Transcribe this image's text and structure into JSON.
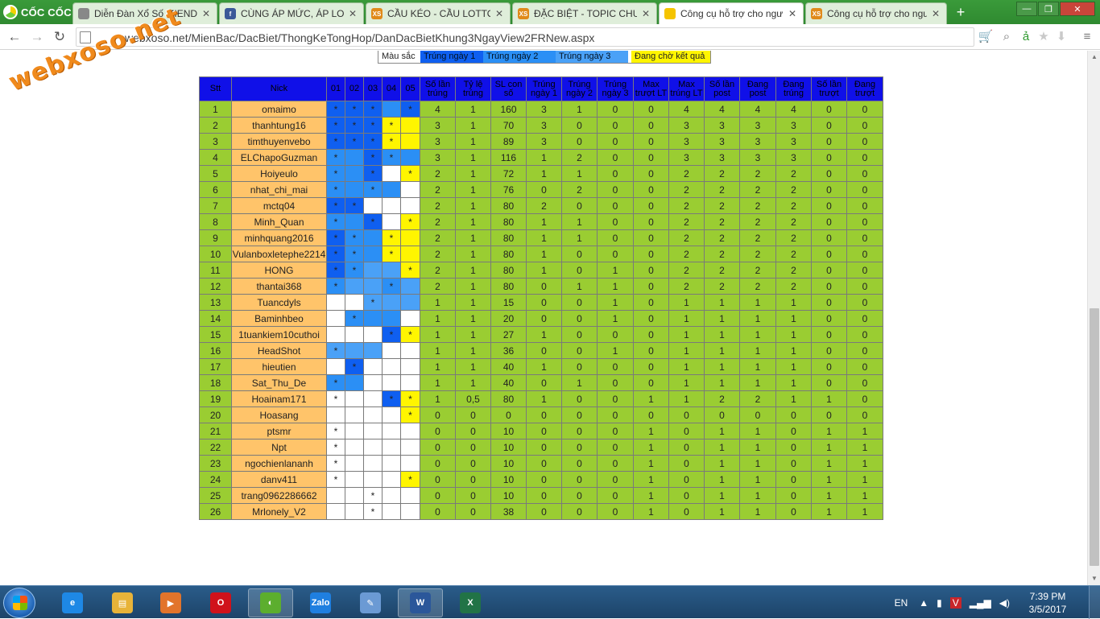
{
  "browser": {
    "brand": "CỐC CỐC",
    "tabs": [
      {
        "label": "Diễn Đàn Xổ Số MIENDA",
        "icon": "doc-icon",
        "color": "#888888"
      },
      {
        "label": "CÙNG ÁP MỨC, ÁP LOẠI",
        "icon": "facebook-icon",
        "color": "#3b5998"
      },
      {
        "label": "CẦU KÉO - CẦU LOTTO.I",
        "icon": "xs-icon",
        "color": "#e08a1a"
      },
      {
        "label": "ĐẶC BIỆT - TOPIC CHUY",
        "icon": "xs-icon",
        "color": "#e08a1a"
      },
      {
        "label": "Công cụ hỗ trợ cho ngư",
        "icon": "coccoc-icon",
        "color": "#f5c400"
      },
      {
        "label": "Công cụ hỗ trợ cho ngư",
        "icon": "xs-icon",
        "color": "#e08a1a"
      }
    ],
    "url": "webxoso.net/MienBac/DacBiet/ThongKeTongHop/DanDacBietKhung3NgayView2FRNew.aspx"
  },
  "watermark": "webxoso.net",
  "legend": {
    "title": "Màu sắc",
    "day1": "Trúng ngày 1",
    "day2": "Trúng ngày 2",
    "day3": "Trúng ngày 3",
    "pending": "Đang chờ kết quả"
  },
  "table": {
    "headers": [
      "Stt",
      "Nick",
      "01",
      "02",
      "03",
      "04",
      "05",
      "Số lần trúng",
      "Tỷ lệ trúng",
      "SL con số",
      "Trúng ngày 1",
      "Trúng ngày 2",
      "Trúng ngày 3",
      "Max trượt LT",
      "Max trúng LT",
      "Số lần post",
      "Đang post",
      "Đang trúng",
      "Số lần trượt",
      "Đang trượt"
    ],
    "rows": [
      {
        "stt": "1",
        "nick": "omaimo",
        "days": [
          [
            "d1",
            "*"
          ],
          [
            "d1",
            "*"
          ],
          [
            "d1",
            "*"
          ],
          [
            "d2",
            ""
          ],
          [
            "d1",
            "*"
          ]
        ],
        "stats": [
          "4",
          "1",
          "160",
          "3",
          "1",
          "0",
          "0",
          "4",
          "4",
          "4",
          "4",
          "0",
          "0"
        ]
      },
      {
        "stt": "2",
        "nick": "thanhtung16",
        "days": [
          [
            "d1",
            "*"
          ],
          [
            "d1",
            "*"
          ],
          [
            "d1",
            "*"
          ],
          [
            "pend",
            "*"
          ],
          [
            "pend",
            ""
          ]
        ],
        "stats": [
          "3",
          "1",
          "70",
          "3",
          "0",
          "0",
          "0",
          "3",
          "3",
          "3",
          "3",
          "0",
          "0"
        ]
      },
      {
        "stt": "3",
        "nick": "timthuyenvebo",
        "days": [
          [
            "d1",
            "*"
          ],
          [
            "d1",
            "*"
          ],
          [
            "d1",
            "*"
          ],
          [
            "pend",
            "*"
          ],
          [
            "pend",
            ""
          ]
        ],
        "stats": [
          "3",
          "1",
          "89",
          "3",
          "0",
          "0",
          "0",
          "3",
          "3",
          "3",
          "3",
          "0",
          "0"
        ]
      },
      {
        "stt": "4",
        "nick": "ELChapoGuzman",
        "days": [
          [
            "d2",
            "*"
          ],
          [
            "d2",
            ""
          ],
          [
            "d1",
            "*"
          ],
          [
            "d2",
            "*"
          ],
          [
            "d2",
            ""
          ]
        ],
        "stats": [
          "3",
          "1",
          "116",
          "1",
          "2",
          "0",
          "0",
          "3",
          "3",
          "3",
          "3",
          "0",
          "0"
        ]
      },
      {
        "stt": "5",
        "nick": "Hoiyeulo",
        "days": [
          [
            "d2",
            "*"
          ],
          [
            "d2",
            ""
          ],
          [
            "d1",
            "*"
          ],
          [
            "w",
            ""
          ],
          [
            "pend",
            "*"
          ]
        ],
        "stats": [
          "2",
          "1",
          "72",
          "1",
          "1",
          "0",
          "0",
          "2",
          "2",
          "2",
          "2",
          "0",
          "0"
        ]
      },
      {
        "stt": "6",
        "nick": "nhat_chi_mai",
        "days": [
          [
            "d2",
            "*"
          ],
          [
            "d2",
            ""
          ],
          [
            "d2",
            "*"
          ],
          [
            "d2",
            ""
          ],
          [
            "w",
            ""
          ]
        ],
        "stats": [
          "2",
          "1",
          "76",
          "0",
          "2",
          "0",
          "0",
          "2",
          "2",
          "2",
          "2",
          "0",
          "0"
        ]
      },
      {
        "stt": "7",
        "nick": "mctq04",
        "days": [
          [
            "d1",
            "*"
          ],
          [
            "d1",
            "*"
          ],
          [
            "w",
            ""
          ],
          [
            "w",
            ""
          ],
          [
            "w",
            ""
          ]
        ],
        "stats": [
          "2",
          "1",
          "80",
          "2",
          "0",
          "0",
          "0",
          "2",
          "2",
          "2",
          "2",
          "0",
          "0"
        ]
      },
      {
        "stt": "8",
        "nick": "Minh_Quan",
        "days": [
          [
            "d2",
            "*"
          ],
          [
            "d2",
            ""
          ],
          [
            "d1",
            "*"
          ],
          [
            "w",
            ""
          ],
          [
            "pend",
            "*"
          ]
        ],
        "stats": [
          "2",
          "1",
          "80",
          "1",
          "1",
          "0",
          "0",
          "2",
          "2",
          "2",
          "2",
          "0",
          "0"
        ]
      },
      {
        "stt": "9",
        "nick": "minhquang2016",
        "days": [
          [
            "d1",
            "*"
          ],
          [
            "d2",
            "*"
          ],
          [
            "d2",
            ""
          ],
          [
            "pend",
            "*"
          ],
          [
            "pend",
            ""
          ]
        ],
        "stats": [
          "2",
          "1",
          "80",
          "1",
          "1",
          "0",
          "0",
          "2",
          "2",
          "2",
          "2",
          "0",
          "0"
        ]
      },
      {
        "stt": "10",
        "nick": "Vulanboxletephe2214",
        "days": [
          [
            "d1",
            "*"
          ],
          [
            "d2",
            "*"
          ],
          [
            "d2",
            ""
          ],
          [
            "pend",
            "*"
          ],
          [
            "pend",
            ""
          ]
        ],
        "stats": [
          "2",
          "1",
          "80",
          "1",
          "0",
          "0",
          "0",
          "2",
          "2",
          "2",
          "2",
          "0",
          "0"
        ]
      },
      {
        "stt": "11",
        "nick": "HONG",
        "days": [
          [
            "d1",
            "*"
          ],
          [
            "d2",
            "*"
          ],
          [
            "d3",
            ""
          ],
          [
            "d3",
            ""
          ],
          [
            "pend",
            "*"
          ]
        ],
        "stats": [
          "2",
          "1",
          "80",
          "1",
          "0",
          "1",
          "0",
          "2",
          "2",
          "2",
          "2",
          "0",
          "0"
        ]
      },
      {
        "stt": "12",
        "nick": "thantai368",
        "days": [
          [
            "d2",
            "*"
          ],
          [
            "d3",
            ""
          ],
          [
            "d3",
            ""
          ],
          [
            "d2",
            "*"
          ],
          [
            "d3",
            ""
          ]
        ],
        "stats": [
          "2",
          "1",
          "80",
          "0",
          "1",
          "1",
          "0",
          "2",
          "2",
          "2",
          "2",
          "0",
          "0"
        ]
      },
      {
        "stt": "13",
        "nick": "Tuancdyls",
        "days": [
          [
            "w",
            ""
          ],
          [
            "w",
            ""
          ],
          [
            "d3",
            "*"
          ],
          [
            "d3",
            ""
          ],
          [
            "d3",
            ""
          ]
        ],
        "stats": [
          "1",
          "1",
          "15",
          "0",
          "0",
          "1",
          "0",
          "1",
          "1",
          "1",
          "1",
          "0",
          "0"
        ]
      },
      {
        "stt": "14",
        "nick": "Baminhbeo",
        "days": [
          [
            "w",
            ""
          ],
          [
            "d2",
            "*"
          ],
          [
            "d2",
            ""
          ],
          [
            "d2",
            ""
          ],
          [
            "w",
            ""
          ]
        ],
        "stats": [
          "1",
          "1",
          "20",
          "0",
          "0",
          "1",
          "0",
          "1",
          "1",
          "1",
          "1",
          "0",
          "0"
        ]
      },
      {
        "stt": "15",
        "nick": "1tuankiem10cuthoi",
        "days": [
          [
            "w",
            ""
          ],
          [
            "w",
            ""
          ],
          [
            "w",
            ""
          ],
          [
            "d1",
            "*"
          ],
          [
            "pend",
            "*"
          ]
        ],
        "stats": [
          "1",
          "1",
          "27",
          "1",
          "0",
          "0",
          "0",
          "1",
          "1",
          "1",
          "1",
          "0",
          "0"
        ]
      },
      {
        "stt": "16",
        "nick": "HeadShot",
        "days": [
          [
            "d3",
            "*"
          ],
          [
            "d3",
            ""
          ],
          [
            "d3",
            ""
          ],
          [
            "w",
            ""
          ],
          [
            "w",
            ""
          ]
        ],
        "stats": [
          "1",
          "1",
          "36",
          "0",
          "0",
          "1",
          "0",
          "1",
          "1",
          "1",
          "1",
          "0",
          "0"
        ]
      },
      {
        "stt": "17",
        "nick": "hieutien",
        "days": [
          [
            "w",
            ""
          ],
          [
            "d1",
            "*"
          ],
          [
            "w",
            ""
          ],
          [
            "w",
            ""
          ],
          [
            "w",
            ""
          ]
        ],
        "stats": [
          "1",
          "1",
          "40",
          "1",
          "0",
          "0",
          "0",
          "1",
          "1",
          "1",
          "1",
          "0",
          "0"
        ]
      },
      {
        "stt": "18",
        "nick": "Sat_Thu_De",
        "days": [
          [
            "d2",
            "*"
          ],
          [
            "d2",
            ""
          ],
          [
            "w",
            ""
          ],
          [
            "w",
            ""
          ],
          [
            "w",
            ""
          ]
        ],
        "stats": [
          "1",
          "1",
          "40",
          "0",
          "1",
          "0",
          "0",
          "1",
          "1",
          "1",
          "1",
          "0",
          "0"
        ]
      },
      {
        "stt": "19",
        "nick": "Hoainam171",
        "days": [
          [
            "w",
            "*"
          ],
          [
            "w",
            ""
          ],
          [
            "w",
            ""
          ],
          [
            "d1",
            "*"
          ],
          [
            "pend",
            "*"
          ]
        ],
        "stats": [
          "1",
          "0,5",
          "80",
          "1",
          "0",
          "0",
          "1",
          "1",
          "2",
          "2",
          "1",
          "1",
          "0"
        ]
      },
      {
        "stt": "20",
        "nick": "Hoasang",
        "days": [
          [
            "w",
            ""
          ],
          [
            "w",
            ""
          ],
          [
            "w",
            ""
          ],
          [
            "w",
            ""
          ],
          [
            "pend",
            "*"
          ]
        ],
        "stats": [
          "0",
          "0",
          "0",
          "0",
          "0",
          "0",
          "0",
          "0",
          "0",
          "0",
          "0",
          "0",
          "0"
        ]
      },
      {
        "stt": "21",
        "nick": "ptsmr",
        "days": [
          [
            "w",
            "*"
          ],
          [
            "w",
            ""
          ],
          [
            "w",
            ""
          ],
          [
            "w",
            ""
          ],
          [
            "w",
            ""
          ]
        ],
        "stats": [
          "0",
          "0",
          "10",
          "0",
          "0",
          "0",
          "1",
          "0",
          "1",
          "1",
          "0",
          "1",
          "1"
        ]
      },
      {
        "stt": "22",
        "nick": "Npt",
        "days": [
          [
            "w",
            "*"
          ],
          [
            "w",
            ""
          ],
          [
            "w",
            ""
          ],
          [
            "w",
            ""
          ],
          [
            "w",
            ""
          ]
        ],
        "stats": [
          "0",
          "0",
          "10",
          "0",
          "0",
          "0",
          "1",
          "0",
          "1",
          "1",
          "0",
          "1",
          "1"
        ]
      },
      {
        "stt": "23",
        "nick": "ngochienlananh",
        "days": [
          [
            "w",
            "*"
          ],
          [
            "w",
            ""
          ],
          [
            "w",
            ""
          ],
          [
            "w",
            ""
          ],
          [
            "w",
            ""
          ]
        ],
        "stats": [
          "0",
          "0",
          "10",
          "0",
          "0",
          "0",
          "1",
          "0",
          "1",
          "1",
          "0",
          "1",
          "1"
        ]
      },
      {
        "stt": "24",
        "nick": "danv411",
        "days": [
          [
            "w",
            "*"
          ],
          [
            "w",
            ""
          ],
          [
            "w",
            ""
          ],
          [
            "w",
            ""
          ],
          [
            "pend",
            "*"
          ]
        ],
        "stats": [
          "0",
          "0",
          "10",
          "0",
          "0",
          "0",
          "1",
          "0",
          "1",
          "1",
          "0",
          "1",
          "1"
        ]
      },
      {
        "stt": "25",
        "nick": "trang0962286662",
        "days": [
          [
            "w",
            ""
          ],
          [
            "w",
            ""
          ],
          [
            "w",
            "*"
          ],
          [
            "w",
            ""
          ],
          [
            "w",
            ""
          ]
        ],
        "stats": [
          "0",
          "0",
          "10",
          "0",
          "0",
          "0",
          "1",
          "0",
          "1",
          "1",
          "0",
          "1",
          "1"
        ]
      },
      {
        "stt": "26",
        "nick": "Mrlonely_V2",
        "days": [
          [
            "w",
            ""
          ],
          [
            "w",
            ""
          ],
          [
            "w",
            "*"
          ],
          [
            "w",
            ""
          ],
          [
            "w",
            ""
          ]
        ],
        "stats": [
          "0",
          "0",
          "38",
          "0",
          "0",
          "0",
          "1",
          "0",
          "1",
          "1",
          "0",
          "1",
          "1"
        ]
      }
    ]
  },
  "taskbar": {
    "apps": [
      {
        "name": "internet-explorer-icon",
        "color": "#1e88e5",
        "glyph": "e"
      },
      {
        "name": "file-explorer-icon",
        "color": "#e8b339",
        "glyph": "▤"
      },
      {
        "name": "media-player-icon",
        "color": "#e2742b",
        "glyph": "▶"
      },
      {
        "name": "opera-icon",
        "color": "#d0121b",
        "glyph": "O"
      },
      {
        "name": "coccoc-icon",
        "color": "#5cae2e",
        "glyph": "◐"
      },
      {
        "name": "zalo-icon",
        "color": "#1f7fe0",
        "glyph": "Zalo"
      },
      {
        "name": "paint-icon",
        "color": "#6b9ad4",
        "glyph": "✎"
      },
      {
        "name": "word-icon",
        "color": "#2b579a",
        "glyph": "W"
      },
      {
        "name": "excel-icon",
        "color": "#217346",
        "glyph": "X"
      }
    ],
    "language": "EN",
    "time": "7:39 PM",
    "date": "3/5/2017"
  }
}
